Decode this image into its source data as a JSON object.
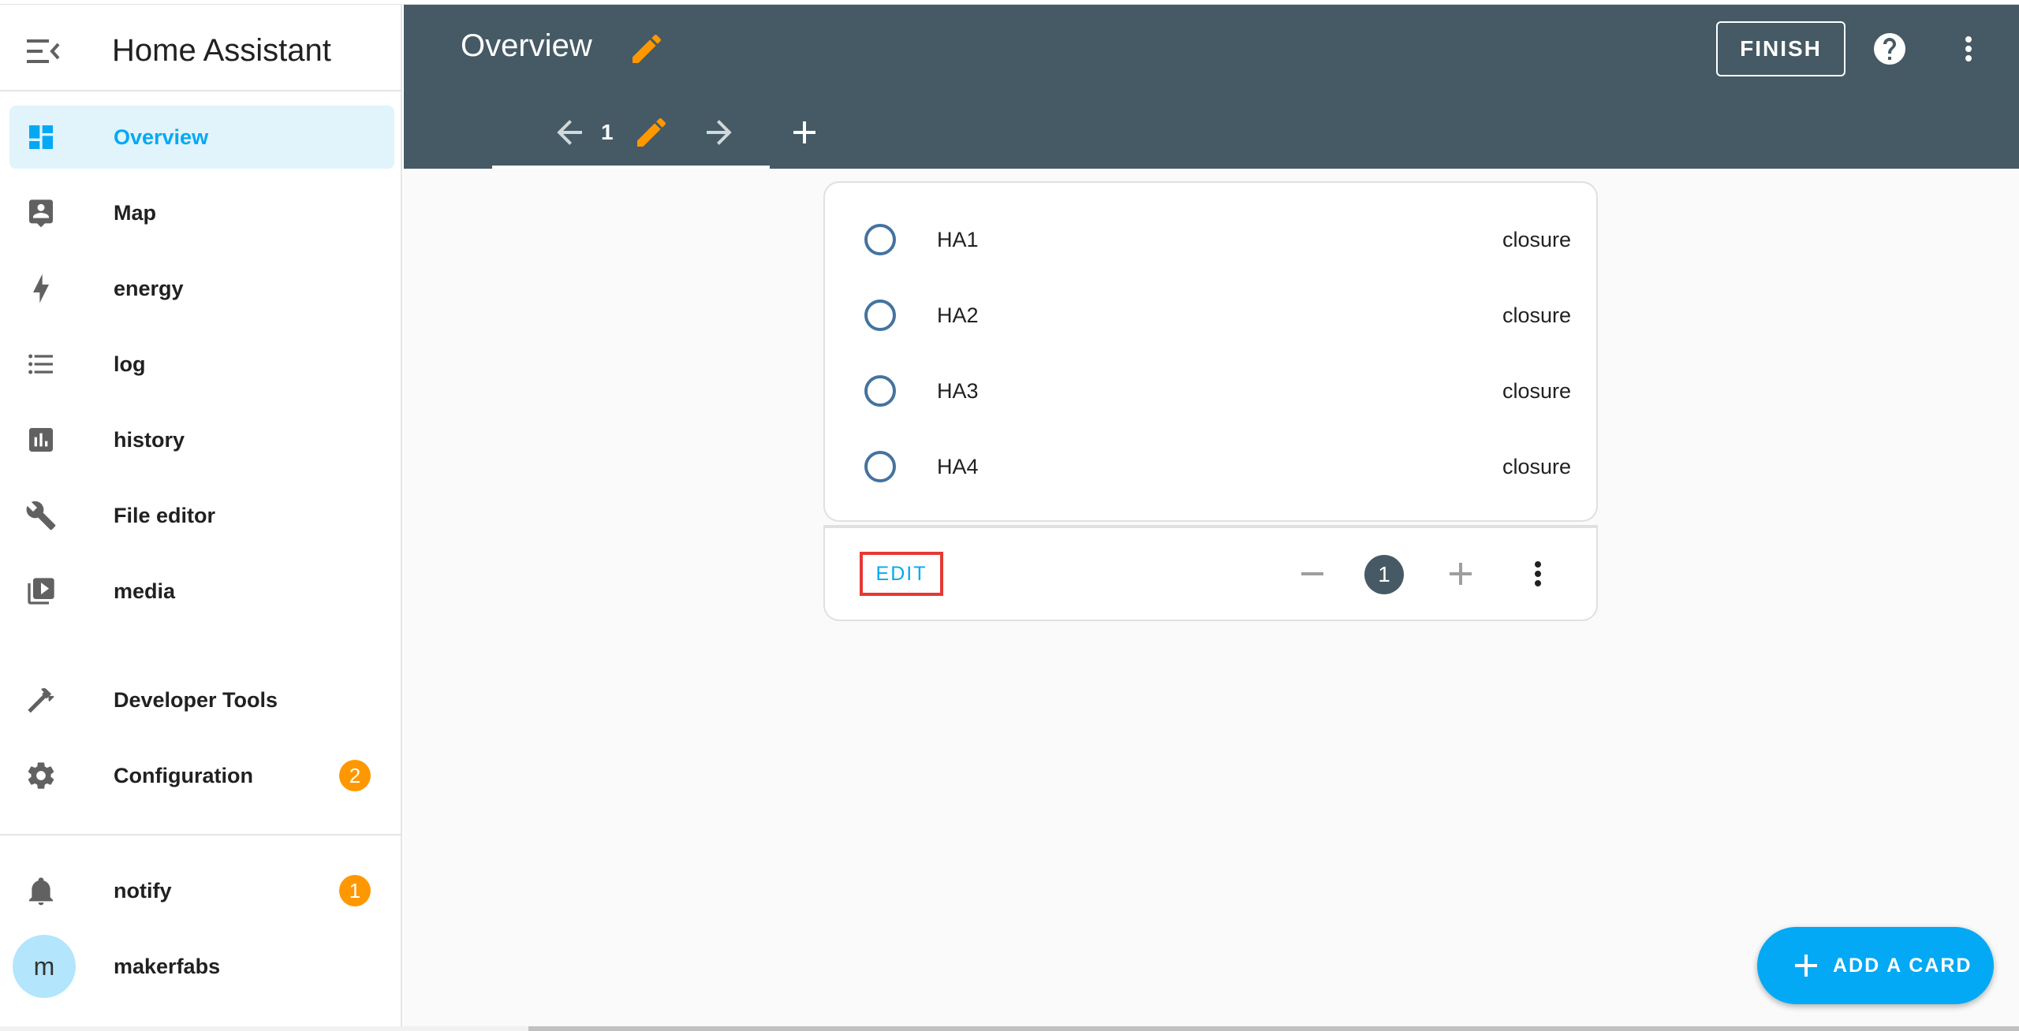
{
  "sidebar": {
    "title": "Home Assistant",
    "items": [
      {
        "label": "Overview",
        "icon": "view-dashboard-icon",
        "active": true
      },
      {
        "label": "Map",
        "icon": "map-icon"
      },
      {
        "label": "energy",
        "icon": "lightning-bolt-icon"
      },
      {
        "label": "log",
        "icon": "format-list-bulleted-icon"
      },
      {
        "label": "history",
        "icon": "chart-box-icon"
      },
      {
        "label": "File editor",
        "icon": "wrench-icon"
      },
      {
        "label": "media",
        "icon": "play-box-multiple-icon"
      }
    ],
    "bottom_items": [
      {
        "label": "Developer Tools",
        "icon": "hammer-icon"
      },
      {
        "label": "Configuration",
        "icon": "cog-icon",
        "badge": "2"
      }
    ],
    "notify": {
      "label": "notify",
      "badge": "1"
    },
    "user": {
      "label": "makerfabs",
      "initial": "m"
    }
  },
  "header": {
    "title": "Overview",
    "finish_label": "FINISH",
    "view_tab": {
      "number": "1"
    }
  },
  "card": {
    "entities": [
      {
        "name": "HA1",
        "state": "closure"
      },
      {
        "name": "HA2",
        "state": "closure"
      },
      {
        "name": "HA3",
        "state": "closure"
      },
      {
        "name": "HA4",
        "state": "closure"
      }
    ],
    "edit_label": "EDIT",
    "position": "1"
  },
  "fab": {
    "label": "ADD A CARD"
  },
  "colors": {
    "accent": "#03a9f4",
    "header": "#455a64",
    "badge": "#ff9800",
    "edit_pencil": "#ff9800",
    "highlight_box": "#e53935"
  }
}
